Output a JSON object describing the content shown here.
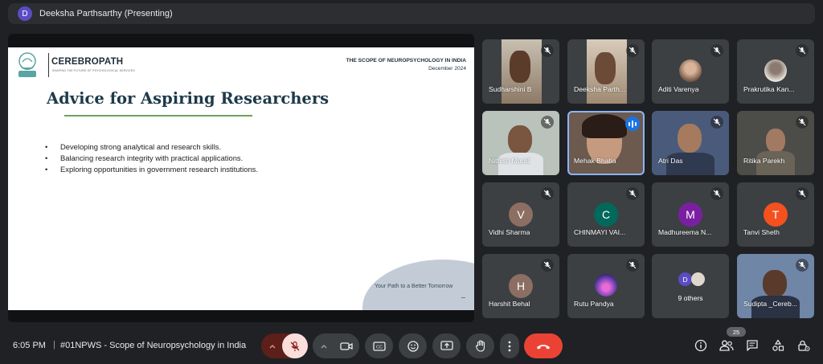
{
  "presenter_bar": {
    "avatar_letter": "D",
    "title": "Deeksha Parthsarthy (Presenting)"
  },
  "slide": {
    "brand": "CEREBROPATH",
    "tagline": "SHAPING THE FUTURE OF PSYCHOLOGICAL SERVICES",
    "topic": "THE SCOPE OF NEUROPSYCHOLOGY IN INDIA",
    "date": "December 2024",
    "heading": "Advice for Aspiring Researchers",
    "bullets": [
      "Developing strong analytical and research skills.",
      "Balancing research integrity with practical applications.",
      "Exploring opportunities in government research institutions."
    ],
    "footer": "Your Path to a Better Tomorrow",
    "accent_color": "#6aa35a"
  },
  "participants": [
    {
      "name": "Sudharshini B",
      "muted": true,
      "kind": "video"
    },
    {
      "name": "Deeksha Parth...",
      "muted": true,
      "kind": "video"
    },
    {
      "name": "Aditi Varenya",
      "muted": true,
      "kind": "avatar-photo"
    },
    {
      "name": "Prakrutika Kan...",
      "muted": true,
      "kind": "avatar-photo"
    },
    {
      "name": "Nithish Murali",
      "muted": true,
      "kind": "video"
    },
    {
      "name": "Mehak Bhatia",
      "muted": false,
      "speaking": true,
      "kind": "video"
    },
    {
      "name": "Atri Das",
      "muted": true,
      "kind": "video"
    },
    {
      "name": "Ritika Parekh",
      "muted": true,
      "kind": "video"
    },
    {
      "name": "Vidhi Sharma",
      "muted": true,
      "kind": "letter",
      "letter": "V",
      "color": "#8d6e63"
    },
    {
      "name": "CHINMAYI VAI...",
      "muted": true,
      "kind": "letter",
      "letter": "C",
      "color": "#00695c"
    },
    {
      "name": "Madhureema N...",
      "muted": true,
      "kind": "letter",
      "letter": "M",
      "color": "#7b1fa2"
    },
    {
      "name": "Tanvi Sheth",
      "muted": true,
      "kind": "letter",
      "letter": "T",
      "color": "#f4511e"
    },
    {
      "name": "Harshit Behal",
      "muted": true,
      "kind": "letter",
      "letter": "H",
      "color": "#8d6e63"
    },
    {
      "name": "Rutu Pandya",
      "muted": true,
      "kind": "avatar-photo"
    },
    {
      "name": "9 others",
      "kind": "others",
      "letter": "D"
    },
    {
      "name": "Sudipta _Cereb...",
      "muted": true,
      "kind": "video"
    }
  ],
  "bottom_bar": {
    "time": "6:05 PM",
    "separator": "|",
    "meeting_title": "#01NPWS - Scope of Neuropsychology in India",
    "people_count": "25",
    "leave_color": "#ea4335"
  },
  "icons": [
    "mic-off-icon",
    "chevron-up-icon",
    "camera-icon",
    "captions-icon",
    "emoji-icon",
    "present-icon",
    "raise-hand-icon",
    "more-icon",
    "end-call-icon",
    "info-icon",
    "people-icon",
    "chat-icon",
    "activities-icon",
    "host-controls-icon"
  ]
}
